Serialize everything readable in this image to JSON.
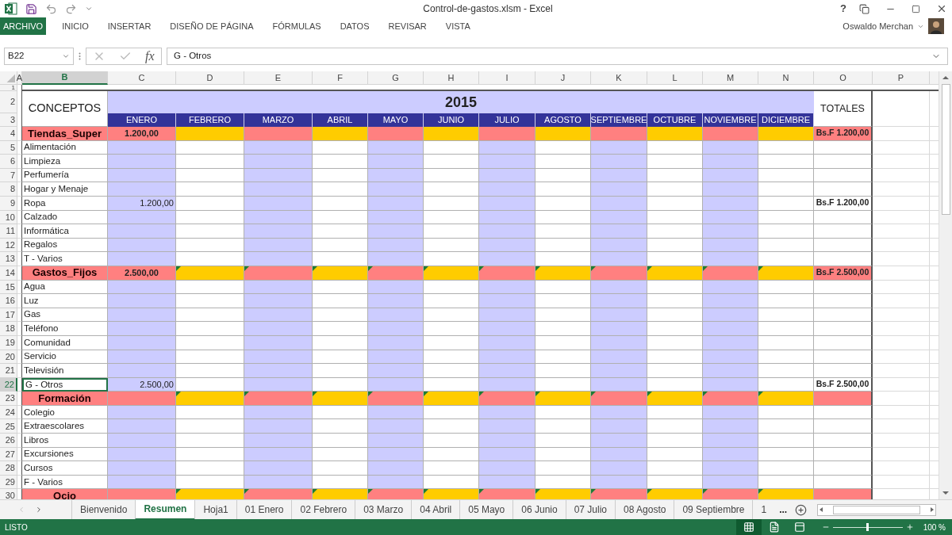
{
  "window": {
    "title": "Control-de-gastos.xlsm - Excel",
    "help": "?"
  },
  "ribbon_tabs": [
    {
      "label": "ARCHIVO",
      "selected": true
    },
    {
      "label": "INICIO",
      "selected": false
    },
    {
      "label": "INSERTAR",
      "selected": false
    },
    {
      "label": "DISEÑO DE PÁGINA",
      "selected": false
    },
    {
      "label": "FÓRMULAS",
      "selected": false
    },
    {
      "label": "DATOS",
      "selected": false
    },
    {
      "label": "REVISAR",
      "selected": false
    },
    {
      "label": "VISTA",
      "selected": false
    }
  ],
  "user": {
    "name": "Oswaldo Merchan"
  },
  "formula_bar": {
    "name_box": "B22",
    "function_label": "fx",
    "value": "G - Otros"
  },
  "columns": [
    {
      "label": "A",
      "selected": false
    },
    {
      "label": "B",
      "selected": true
    },
    {
      "label": "C",
      "selected": false
    },
    {
      "label": "D",
      "selected": false
    },
    {
      "label": "E",
      "selected": false
    },
    {
      "label": "F",
      "selected": false
    },
    {
      "label": "G",
      "selected": false
    },
    {
      "label": "H",
      "selected": false
    },
    {
      "label": "I",
      "selected": false
    },
    {
      "label": "J",
      "selected": false
    },
    {
      "label": "K",
      "selected": false
    },
    {
      "label": "L",
      "selected": false
    },
    {
      "label": "M",
      "selected": false
    },
    {
      "label": "N",
      "selected": false
    },
    {
      "label": "O",
      "selected": false
    },
    {
      "label": "P",
      "selected": false
    }
  ],
  "header": {
    "row_numbers": [
      "1",
      "2",
      "3"
    ],
    "concepts": "CONCEPTOS",
    "year": "2015",
    "totals": "TOTALES",
    "months": [
      "ENERO",
      "FEBRERO",
      "MARZO",
      "ABRIL",
      "MAYO",
      "JUNIO",
      "JULIO",
      "AGOSTO",
      "SEPTIEMBRE",
      "OCTUBRE",
      "NOVIEMBRE",
      "DICIEMBRE"
    ]
  },
  "rows": [
    {
      "number": "4",
      "kind": "category",
      "concept": "Tiendas_Super",
      "amount": "1.200,00",
      "total": "Bs.F 1.200,00",
      "flagged": false,
      "selected": false
    },
    {
      "number": "5",
      "kind": "item",
      "concept": "Alimentación",
      "selected": false
    },
    {
      "number": "6",
      "kind": "item",
      "concept": "Limpieza",
      "selected": false
    },
    {
      "number": "7",
      "kind": "item",
      "concept": "Perfumería",
      "selected": false
    },
    {
      "number": "8",
      "kind": "item",
      "concept": "Hogar y Menaje",
      "selected": false
    },
    {
      "number": "9",
      "kind": "item",
      "concept": "Ropa",
      "amount": "1.200,00",
      "total": "Bs.F 1.200,00",
      "selected": false
    },
    {
      "number": "10",
      "kind": "item",
      "concept": "Calzado",
      "selected": false
    },
    {
      "number": "11",
      "kind": "item",
      "concept": "Informática",
      "selected": false
    },
    {
      "number": "12",
      "kind": "item",
      "concept": "Regalos",
      "selected": false
    },
    {
      "number": "13",
      "kind": "item",
      "concept": "T - Varios",
      "selected": false
    },
    {
      "number": "14",
      "kind": "category",
      "concept": "Gastos_Fijos",
      "amount": "2.500,00",
      "total": "Bs.F 2.500,00",
      "flagged": true,
      "selected": false
    },
    {
      "number": "15",
      "kind": "item",
      "concept": "Agua",
      "selected": false
    },
    {
      "number": "16",
      "kind": "item",
      "concept": "Luz",
      "selected": false
    },
    {
      "number": "17",
      "kind": "item",
      "concept": "Gas",
      "selected": false
    },
    {
      "number": "18",
      "kind": "item",
      "concept": "Teléfono",
      "selected": false
    },
    {
      "number": "19",
      "kind": "item",
      "concept": "Comunidad",
      "selected": false
    },
    {
      "number": "20",
      "kind": "item",
      "concept": "Servicio",
      "selected": false
    },
    {
      "number": "21",
      "kind": "item",
      "concept": "Televisión",
      "selected": false
    },
    {
      "number": "22",
      "kind": "item",
      "concept": "G - Otros",
      "amount": "2.500,00",
      "total": "Bs.F 2.500,00",
      "selected": true
    },
    {
      "number": "23",
      "kind": "category",
      "concept": "Formación",
      "flagged": true,
      "selected": false
    },
    {
      "number": "24",
      "kind": "item",
      "concept": "Colegio",
      "selected": false
    },
    {
      "number": "25",
      "kind": "item",
      "concept": "Extraescolares",
      "selected": false
    },
    {
      "number": "26",
      "kind": "item",
      "concept": "Libros",
      "selected": false
    },
    {
      "number": "27",
      "kind": "item",
      "concept": "Excursiones",
      "selected": false
    },
    {
      "number": "28",
      "kind": "item",
      "concept": "Cursos",
      "selected": false
    },
    {
      "number": "29",
      "kind": "item",
      "concept": "F - Varios",
      "selected": false
    },
    {
      "number": "30",
      "kind": "category",
      "concept": "Ocio",
      "flagged": true,
      "selected": false
    }
  ],
  "sheet_tabs": [
    {
      "label": "Bienvenido",
      "selected": false
    },
    {
      "label": "Resumen",
      "selected": true
    },
    {
      "label": "Hoja1",
      "selected": false
    },
    {
      "label": "01 Enero",
      "selected": false
    },
    {
      "label": "02 Febrero",
      "selected": false
    },
    {
      "label": "03 Marzo",
      "selected": false
    },
    {
      "label": "04 Abril",
      "selected": false
    },
    {
      "label": "05 Mayo",
      "selected": false
    },
    {
      "label": "06 Junio",
      "selected": false
    },
    {
      "label": "07 Julio",
      "selected": false
    },
    {
      "label": "08 Agosto",
      "selected": false
    },
    {
      "label": "09 Septiembre",
      "selected": false
    },
    {
      "label": "1",
      "selected": false
    }
  ],
  "more_tabs": "...",
  "status_bar": {
    "status": "LISTO",
    "views": [
      {
        "kind": "normal",
        "selected": true
      },
      {
        "kind": "page_layout",
        "selected": false
      },
      {
        "kind": "page_break",
        "selected": false
      }
    ],
    "zoom": {
      "level": 0.5,
      "reading": "100 %"
    }
  }
}
